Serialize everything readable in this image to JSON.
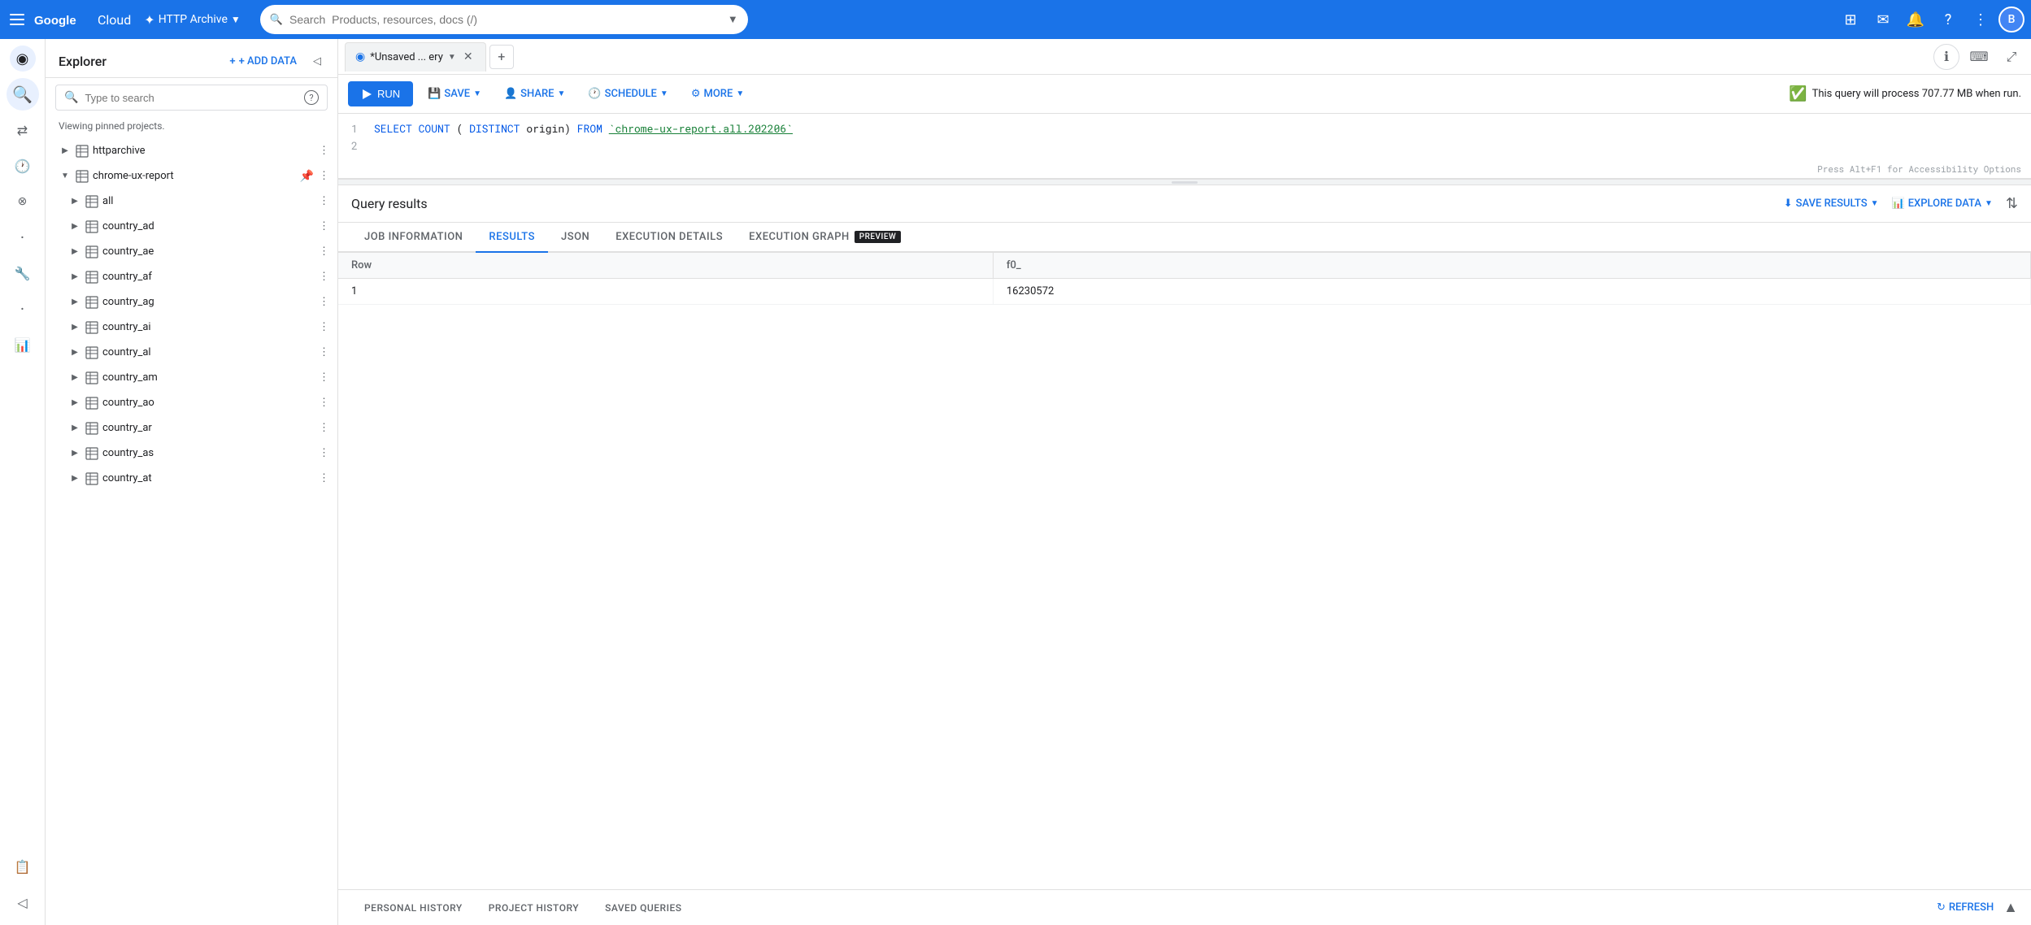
{
  "topnav": {
    "project_name": "HTTP Archive",
    "search_placeholder": "Search  Products, resources, docs (/)",
    "avatar_letter": "B"
  },
  "explorer": {
    "title": "Explorer",
    "add_data_label": "+ ADD DATA",
    "search_placeholder": "Type to search",
    "viewing_text": "Viewing pinned projects.",
    "collapse_tooltip": "Collapse"
  },
  "tree": {
    "items": [
      {
        "level": 0,
        "label": "httparchive",
        "type": "dataset",
        "expanded": false,
        "pinned": false
      },
      {
        "level": 0,
        "label": "chrome-ux-report",
        "type": "dataset",
        "expanded": true,
        "pinned": true
      },
      {
        "level": 1,
        "label": "all",
        "type": "table",
        "expanded": false
      },
      {
        "level": 1,
        "label": "country_ad",
        "type": "table",
        "expanded": false
      },
      {
        "level": 1,
        "label": "country_ae",
        "type": "table",
        "expanded": false
      },
      {
        "level": 1,
        "label": "country_af",
        "type": "table",
        "expanded": false
      },
      {
        "level": 1,
        "label": "country_ag",
        "type": "table",
        "expanded": false
      },
      {
        "level": 1,
        "label": "country_ai",
        "type": "table",
        "expanded": false
      },
      {
        "level": 1,
        "label": "country_al",
        "type": "table",
        "expanded": false
      },
      {
        "level": 1,
        "label": "country_am",
        "type": "table",
        "expanded": false
      },
      {
        "level": 1,
        "label": "country_ao",
        "type": "table",
        "expanded": false
      },
      {
        "level": 1,
        "label": "country_ar",
        "type": "table",
        "expanded": false
      },
      {
        "level": 1,
        "label": "country_as",
        "type": "table",
        "expanded": false
      },
      {
        "level": 1,
        "label": "country_at",
        "type": "table",
        "expanded": false
      }
    ]
  },
  "query_tab": {
    "label": "*Unsaved ... ery",
    "tooltip": "*Unsaved Query"
  },
  "toolbar": {
    "run_label": "RUN",
    "save_label": "SAVE",
    "share_label": "SHARE",
    "schedule_label": "SCHEDULE",
    "more_label": "MORE",
    "notice_text": "This query will process 707.77 MB when run."
  },
  "sql_editor": {
    "line1": "SELECT COUNT(DISTINCT origin) FROM `chrome-ux-report.all.202206`",
    "line1_num": "1",
    "line2_num": "2",
    "accessibility_hint": "Press Alt+F1 for Accessibility Options"
  },
  "results": {
    "title": "Query results",
    "save_results_label": "SAVE RESULTS",
    "explore_data_label": "EXPLORE DATA",
    "tabs": [
      {
        "label": "JOB INFORMATION",
        "active": false
      },
      {
        "label": "RESULTS",
        "active": true
      },
      {
        "label": "JSON",
        "active": false
      },
      {
        "label": "EXECUTION DETAILS",
        "active": false
      },
      {
        "label": "EXECUTION GRAPH",
        "active": false,
        "badge": "PREVIEW"
      }
    ],
    "table": {
      "columns": [
        "Row",
        "f0_"
      ],
      "rows": [
        {
          "row": "1",
          "f0_": "16230572"
        }
      ]
    }
  },
  "bottom_bar": {
    "tabs": [
      "PERSONAL HISTORY",
      "PROJECT HISTORY",
      "SAVED QUERIES"
    ],
    "refresh_label": "REFRESH"
  },
  "side_icons": [
    {
      "name": "search",
      "label": "Search",
      "active": true,
      "symbol": "🔍"
    },
    {
      "name": "transfers",
      "label": "Transfers",
      "active": false,
      "symbol": "⇄"
    },
    {
      "name": "history",
      "label": "History",
      "active": false,
      "symbol": "🕐"
    },
    {
      "name": "scheduled",
      "label": "Scheduled Queries",
      "active": false,
      "symbol": "⊗"
    },
    {
      "name": "dot1",
      "label": "",
      "active": false,
      "symbol": "·"
    },
    {
      "name": "wrench",
      "label": "Wrench",
      "active": false,
      "symbol": "🔧"
    },
    {
      "name": "dot2",
      "label": "",
      "active": false,
      "symbol": "·"
    },
    {
      "name": "analytics",
      "label": "Analytics",
      "active": false,
      "symbol": "📊"
    },
    {
      "name": "clipboard",
      "label": "Clipboard",
      "active": false,
      "symbol": "📋"
    }
  ]
}
